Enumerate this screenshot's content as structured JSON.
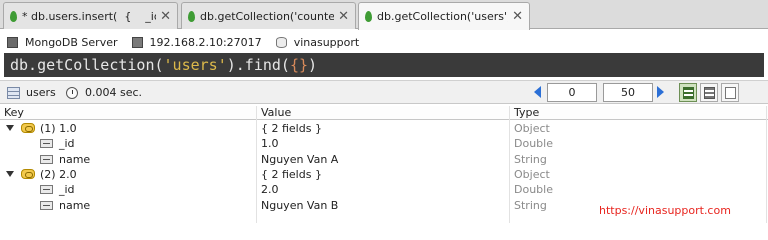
{
  "tabs": [
    {
      "label": "* db.users.insert(  {    _id...",
      "active": false,
      "close": "✕"
    },
    {
      "label": "db.getCollection('counters'...",
      "active": false,
      "close": "✕"
    },
    {
      "label": "db.getCollection('users').fin...",
      "active": true,
      "close": "✕"
    }
  ],
  "connection": {
    "server": "MongoDB Server",
    "host": "192.168.2.10:27017",
    "database": "vinasupport"
  },
  "query": {
    "prefix": "db.getCollection(",
    "string": "'users'",
    "middle": ").find(",
    "braces": "{}",
    "suffix": ")"
  },
  "results_toolbar": {
    "collection": "users",
    "time": "0.004 sec.",
    "skip": "0",
    "limit": "50"
  },
  "table": {
    "headers": {
      "key": "Key",
      "value": "Value",
      "type": "Type"
    },
    "rows": [
      {
        "key": "(1) 1.0",
        "value": "{ 2 fields }",
        "type": "Object"
      },
      {
        "key": "_id",
        "value": "1.0",
        "type": "Double"
      },
      {
        "key": "name",
        "value": "Nguyen Van A",
        "type": "String"
      },
      {
        "key": "(2) 2.0",
        "value": "{ 2 fields }",
        "type": "Object"
      },
      {
        "key": "_id",
        "value": "2.0",
        "type": "Double"
      },
      {
        "key": "name",
        "value": "Nguyen Van B",
        "type": "String"
      }
    ]
  },
  "watermark": "https://vinasupport.com",
  "colors": {
    "query_background": "#3a3a3a",
    "query_string": "#dcb94a",
    "leaf_icon": "#3f9c35",
    "pager_arrows": "#2b6fd6",
    "watermark": "#e8251f"
  }
}
